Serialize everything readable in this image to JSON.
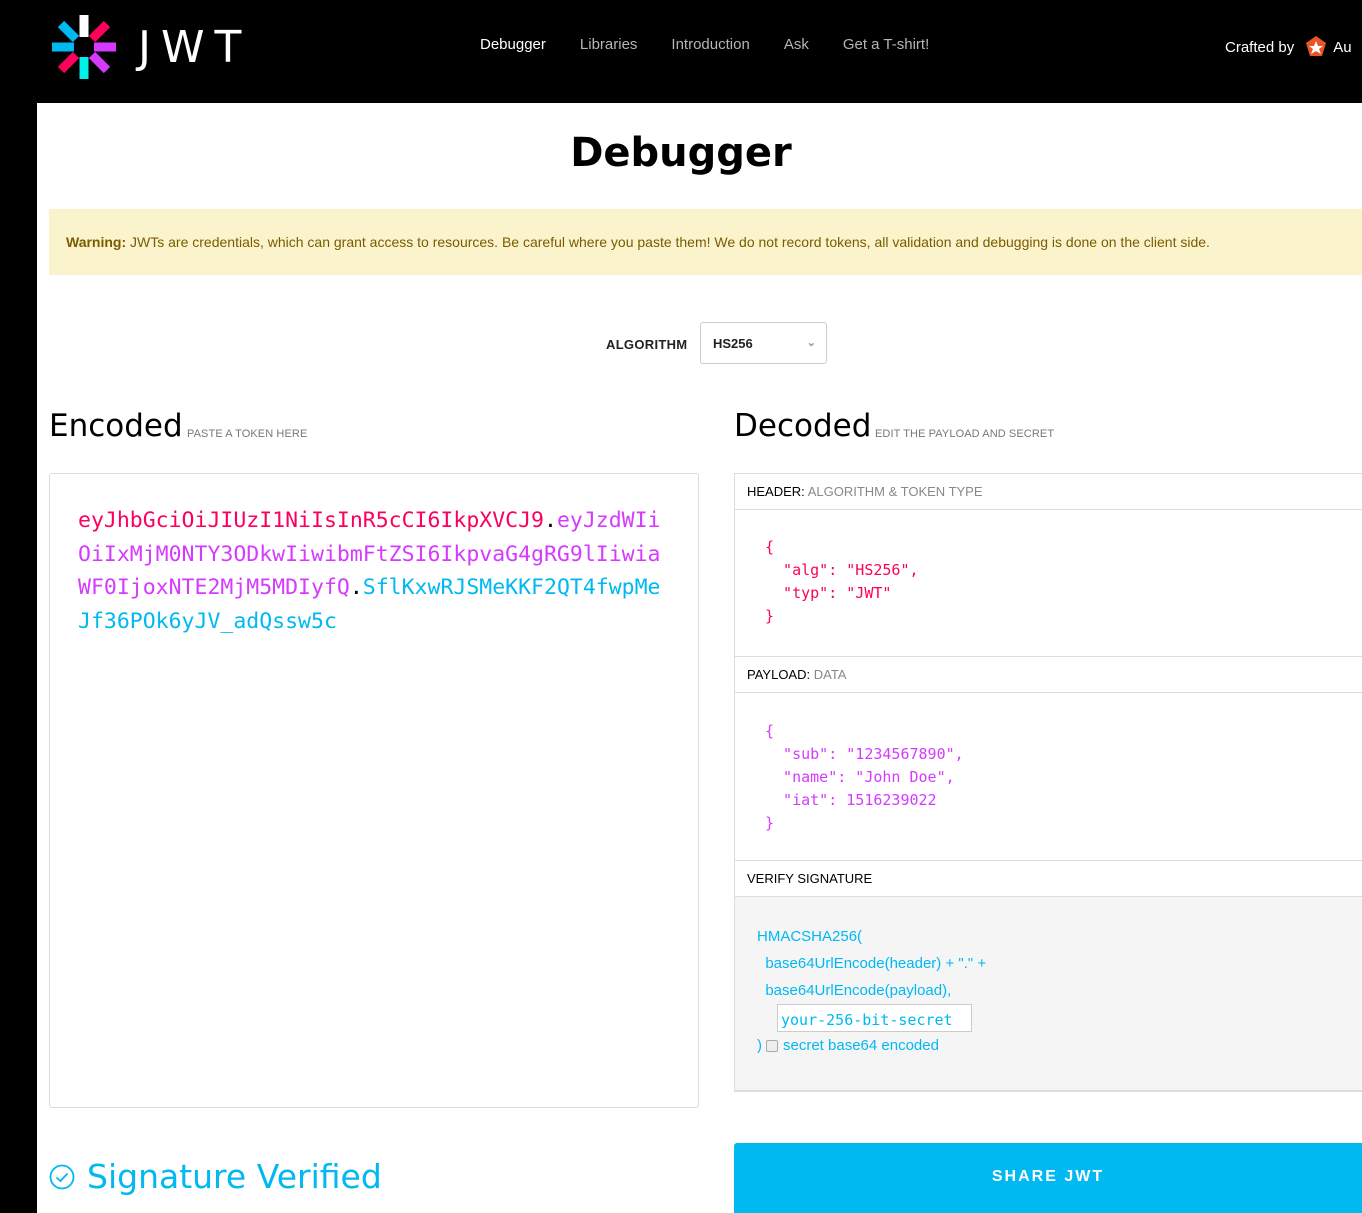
{
  "header": {
    "logo_text": "JWT",
    "nav": [
      {
        "label": "Debugger",
        "active": true
      },
      {
        "label": "Libraries"
      },
      {
        "label": "Introduction"
      },
      {
        "label": "Ask"
      },
      {
        "label": "Get a T-shirt!"
      }
    ],
    "crafted_by": "Crafted by",
    "brand_partial": "Au"
  },
  "page": {
    "title": "Debugger"
  },
  "warning": {
    "strong": "Warning:",
    "text": " JWTs are credentials, which can grant access to resources. Be careful where you paste them! We do not record tokens, all validation and debugging is done on the client side."
  },
  "algorithm": {
    "label": "ALGORITHM",
    "value": "HS256"
  },
  "encoded": {
    "title": "Encoded",
    "subtitle": "PASTE A TOKEN HERE",
    "header_part": "eyJhbGciOiJIUzI1NiIsInR5cCI6IkpXVCJ9",
    "payload_part": "eyJzdWIiOiIxMjM0NTY3ODkwIiwibmFtZSI6IkpvaG4gRG9lIiwiaWF0IjoxNTE2MjM5MDIyfQ",
    "signature_part": "SflKxwRJSMeKKF2QT4fwpMeJf36POk6yJV_adQssw5c",
    "dot": "."
  },
  "decoded": {
    "title": "Decoded",
    "subtitle": "EDIT THE PAYLOAD AND SECRET",
    "header_label": "HEADER:",
    "header_sublabel": "ALGORITHM & TOKEN TYPE",
    "header_json": "{\n  \"alg\": \"HS256\",\n  \"typ\": \"JWT\"\n}",
    "payload_label": "PAYLOAD:",
    "payload_sublabel": "DATA",
    "payload_json": "{\n  \"sub\": \"1234567890\",\n  \"name\": \"John Doe\",\n  \"iat\": 1516239022\n}",
    "verify_label": "VERIFY SIGNATURE",
    "verify_line1": "HMACSHA256(",
    "verify_line2": "  base64UrlEncode(header) + \".\" +",
    "verify_line3": "  base64UrlEncode(payload),",
    "secret_value": "your-256-bit-secret",
    "close_paren": ")",
    "base64_label": "secret base64 encoded"
  },
  "status": {
    "verified_text": "Signature Verified"
  },
  "share_button": "SHARE JWT",
  "colors": {
    "header_color": "#fb015b",
    "payload_color": "#d63aff",
    "signature_color": "#00b9f1",
    "warning_bg": "#fbf3cc"
  }
}
